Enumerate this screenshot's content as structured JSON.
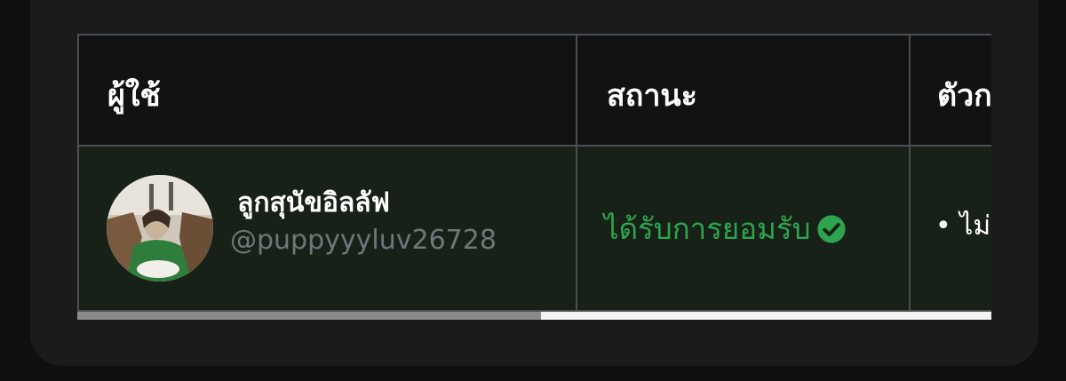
{
  "table": {
    "headers": {
      "user": "ผู้ใช้",
      "status": "สถานะ",
      "third": "ตัวก"
    },
    "rows": [
      {
        "display_name": "ลูกสุนัขอิลลัฟ",
        "handle": "@puppyyyluv26728",
        "status": "ได้รับการยอมรับ",
        "rule_bullet": "• ไม่"
      }
    ]
  },
  "colors": {
    "accepted": "#2ea44f",
    "row_background": "#172117",
    "border": "#4a4f54"
  },
  "icons": {
    "status_icon": "check-circle-icon"
  },
  "scroll": {
    "horizontal_progress": 0.507
  }
}
